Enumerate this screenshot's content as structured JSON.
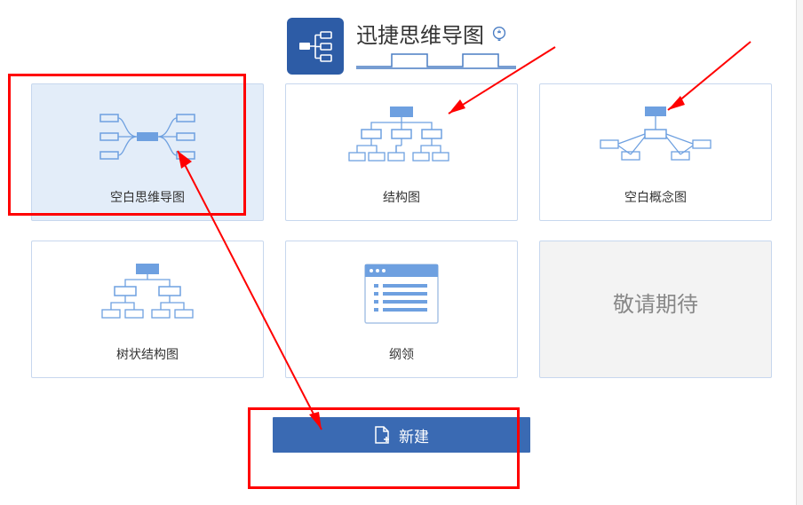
{
  "header": {
    "title": "迅捷思维导图"
  },
  "templates": [
    {
      "id": "mindmap-blank",
      "label": "空白思维导图"
    },
    {
      "id": "structure",
      "label": "结构图"
    },
    {
      "id": "concept-blank",
      "label": "空白概念图"
    },
    {
      "id": "tree",
      "label": "树状结构图"
    },
    {
      "id": "outline",
      "label": "纲领"
    }
  ],
  "placeholder": {
    "label": "敬请期待"
  },
  "actions": {
    "create": "新建"
  },
  "colors": {
    "primary": "#3a6ab3",
    "cardBorder": "#c7d7ee",
    "selectedBg": "#e3edf9",
    "annotation": "#ff0000"
  }
}
